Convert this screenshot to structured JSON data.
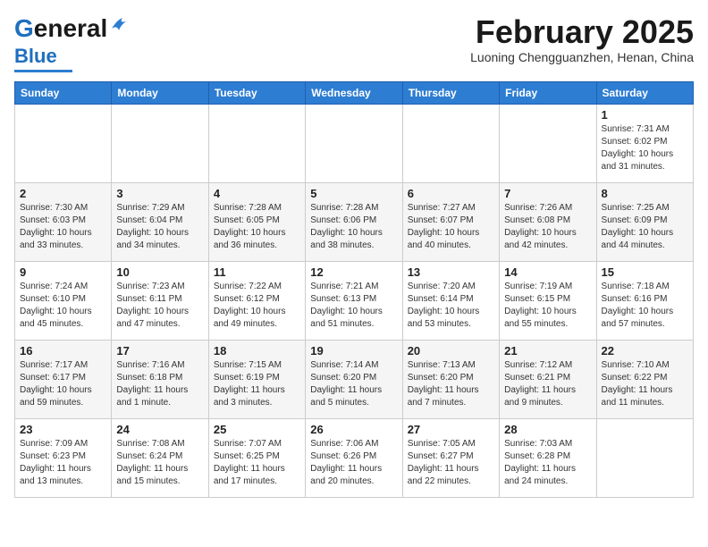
{
  "header": {
    "logo_line1": "General",
    "logo_line2": "Blue",
    "month": "February 2025",
    "location": "Luoning Chengguanzhen, Henan, China"
  },
  "days_of_week": [
    "Sunday",
    "Monday",
    "Tuesday",
    "Wednesday",
    "Thursday",
    "Friday",
    "Saturday"
  ],
  "weeks": [
    [
      {
        "day": "",
        "info": ""
      },
      {
        "day": "",
        "info": ""
      },
      {
        "day": "",
        "info": ""
      },
      {
        "day": "",
        "info": ""
      },
      {
        "day": "",
        "info": ""
      },
      {
        "day": "",
        "info": ""
      },
      {
        "day": "1",
        "info": "Sunrise: 7:31 AM\nSunset: 6:02 PM\nDaylight: 10 hours and 31 minutes."
      }
    ],
    [
      {
        "day": "2",
        "info": "Sunrise: 7:30 AM\nSunset: 6:03 PM\nDaylight: 10 hours and 33 minutes."
      },
      {
        "day": "3",
        "info": "Sunrise: 7:29 AM\nSunset: 6:04 PM\nDaylight: 10 hours and 34 minutes."
      },
      {
        "day": "4",
        "info": "Sunrise: 7:28 AM\nSunset: 6:05 PM\nDaylight: 10 hours and 36 minutes."
      },
      {
        "day": "5",
        "info": "Sunrise: 7:28 AM\nSunset: 6:06 PM\nDaylight: 10 hours and 38 minutes."
      },
      {
        "day": "6",
        "info": "Sunrise: 7:27 AM\nSunset: 6:07 PM\nDaylight: 10 hours and 40 minutes."
      },
      {
        "day": "7",
        "info": "Sunrise: 7:26 AM\nSunset: 6:08 PM\nDaylight: 10 hours and 42 minutes."
      },
      {
        "day": "8",
        "info": "Sunrise: 7:25 AM\nSunset: 6:09 PM\nDaylight: 10 hours and 44 minutes."
      }
    ],
    [
      {
        "day": "9",
        "info": "Sunrise: 7:24 AM\nSunset: 6:10 PM\nDaylight: 10 hours and 45 minutes."
      },
      {
        "day": "10",
        "info": "Sunrise: 7:23 AM\nSunset: 6:11 PM\nDaylight: 10 hours and 47 minutes."
      },
      {
        "day": "11",
        "info": "Sunrise: 7:22 AM\nSunset: 6:12 PM\nDaylight: 10 hours and 49 minutes."
      },
      {
        "day": "12",
        "info": "Sunrise: 7:21 AM\nSunset: 6:13 PM\nDaylight: 10 hours and 51 minutes."
      },
      {
        "day": "13",
        "info": "Sunrise: 7:20 AM\nSunset: 6:14 PM\nDaylight: 10 hours and 53 minutes."
      },
      {
        "day": "14",
        "info": "Sunrise: 7:19 AM\nSunset: 6:15 PM\nDaylight: 10 hours and 55 minutes."
      },
      {
        "day": "15",
        "info": "Sunrise: 7:18 AM\nSunset: 6:16 PM\nDaylight: 10 hours and 57 minutes."
      }
    ],
    [
      {
        "day": "16",
        "info": "Sunrise: 7:17 AM\nSunset: 6:17 PM\nDaylight: 10 hours and 59 minutes."
      },
      {
        "day": "17",
        "info": "Sunrise: 7:16 AM\nSunset: 6:18 PM\nDaylight: 11 hours and 1 minute."
      },
      {
        "day": "18",
        "info": "Sunrise: 7:15 AM\nSunset: 6:19 PM\nDaylight: 11 hours and 3 minutes."
      },
      {
        "day": "19",
        "info": "Sunrise: 7:14 AM\nSunset: 6:20 PM\nDaylight: 11 hours and 5 minutes."
      },
      {
        "day": "20",
        "info": "Sunrise: 7:13 AM\nSunset: 6:20 PM\nDaylight: 11 hours and 7 minutes."
      },
      {
        "day": "21",
        "info": "Sunrise: 7:12 AM\nSunset: 6:21 PM\nDaylight: 11 hours and 9 minutes."
      },
      {
        "day": "22",
        "info": "Sunrise: 7:10 AM\nSunset: 6:22 PM\nDaylight: 11 hours and 11 minutes."
      }
    ],
    [
      {
        "day": "23",
        "info": "Sunrise: 7:09 AM\nSunset: 6:23 PM\nDaylight: 11 hours and 13 minutes."
      },
      {
        "day": "24",
        "info": "Sunrise: 7:08 AM\nSunset: 6:24 PM\nDaylight: 11 hours and 15 minutes."
      },
      {
        "day": "25",
        "info": "Sunrise: 7:07 AM\nSunset: 6:25 PM\nDaylight: 11 hours and 17 minutes."
      },
      {
        "day": "26",
        "info": "Sunrise: 7:06 AM\nSunset: 6:26 PM\nDaylight: 11 hours and 20 minutes."
      },
      {
        "day": "27",
        "info": "Sunrise: 7:05 AM\nSunset: 6:27 PM\nDaylight: 11 hours and 22 minutes."
      },
      {
        "day": "28",
        "info": "Sunrise: 7:03 AM\nSunset: 6:28 PM\nDaylight: 11 hours and 24 minutes."
      },
      {
        "day": "",
        "info": ""
      }
    ]
  ]
}
